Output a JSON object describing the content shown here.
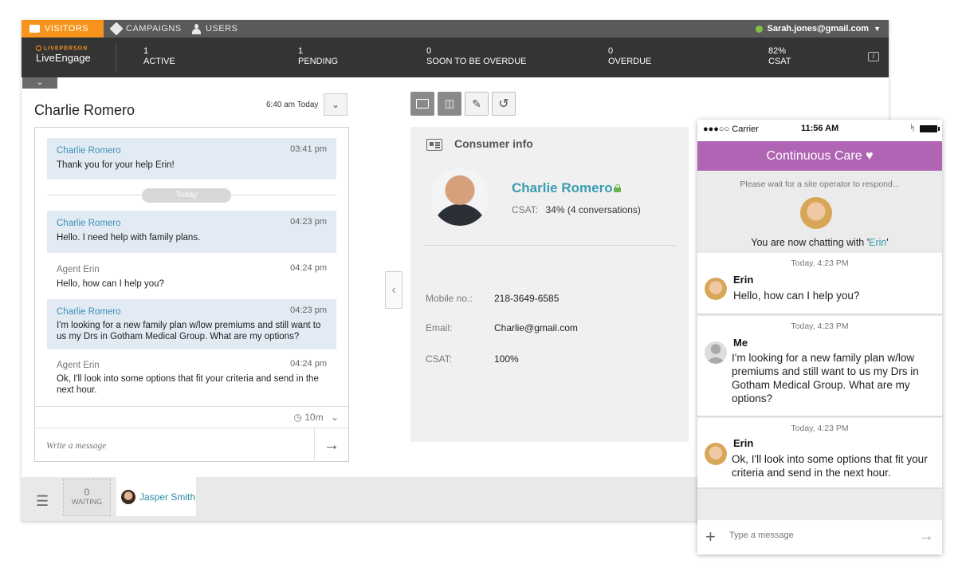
{
  "topnav": {
    "visitors": "VISITORS",
    "campaigns": "CAMPAIGNS",
    "users": "USERS",
    "user_email": "Sarah.jones@gmail.com",
    "status_color": "#7dc242"
  },
  "logo": {
    "brand": "LIVEPERSON",
    "product": "LiveEngage"
  },
  "stats": [
    {
      "value": "1",
      "label": "ACTIVE"
    },
    {
      "value": "1",
      "label": "PENDING"
    },
    {
      "value": "0",
      "label": "SOON TO BE OVERDUE"
    },
    {
      "value": "0",
      "label": "OVERDUE"
    },
    {
      "value": "82%",
      "label": "CSAT"
    }
  ],
  "chat": {
    "visitor_name": "Charlie Romero",
    "time": "6:40 am Today",
    "day_divider": "Today",
    "messages": [
      {
        "author": "Charlie Romero",
        "time": "03:41 pm",
        "text": "Thank you for your help Erin!"
      },
      {
        "author": "Charlie Romero",
        "time": "04:23 pm",
        "text": "Hello. I need help with family plans."
      },
      {
        "author": "Agent Erin",
        "time": "04:24 pm",
        "text": "Hello, how can I help you?"
      },
      {
        "author": "Charlie Romero",
        "time": "04:23 pm",
        "text": "I'm looking for a new family plan w/low premiums and still want to us my Drs in Gotham Medical Group. What are my options?"
      },
      {
        "author": "Agent Erin",
        "time": "04:24 pm",
        "text": "Ok, I'll look into some options that fit your criteria and send in the next hour."
      }
    ],
    "timer": "10m",
    "compose_placeholder": "Write a message"
  },
  "consumer": {
    "title": "Consumer info",
    "name": "Charlie Romero",
    "csat_label": "CSAT:",
    "csat_value": "34%  (4 conversations)",
    "fields": [
      {
        "key": "Mobile no.:",
        "value": "218-3649-6585"
      },
      {
        "key": "Email:",
        "value": "Charlie@gmail.com"
      },
      {
        "key": "CSAT:",
        "value": "100%"
      }
    ]
  },
  "bottom": {
    "waiting_count": "0",
    "waiting_label": "WAITING",
    "visitor_tab": "Jasper Smith"
  },
  "phone": {
    "status_left": "●●●○○ Carrier",
    "status_time": "11:56 AM",
    "header": "Continuous Care ♥",
    "header_color": "#b064b4",
    "wait_text": "Please wait for a site operator to respond...",
    "now_prefix": "You are now chatting with '",
    "now_name": "Erin",
    "now_suffix": "'",
    "messages": [
      {
        "time": "Today, 4:23 PM",
        "name": "Erin",
        "text": "Hello, how can I help you?"
      },
      {
        "time": "Today, 4:23 PM",
        "name": "Me",
        "text": "I'm looking for a new family plan w/low premiums and still want to us my Drs in Gotham Medical Group. What are my options?"
      },
      {
        "time": "Today, 4:23 PM",
        "name": "Erin",
        "text": "Ok, I'll look into some options that fit your criteria and send in the next hour."
      }
    ],
    "compose_placeholder": "Type a message"
  }
}
